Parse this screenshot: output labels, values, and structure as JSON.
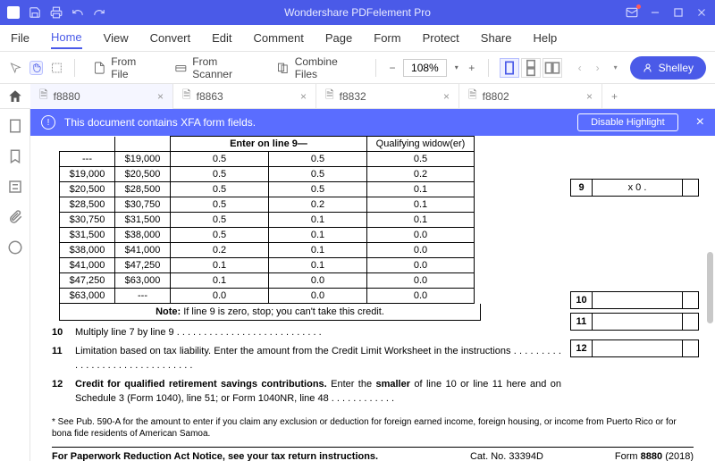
{
  "titlebar": {
    "title": "Wondershare PDFelement Pro"
  },
  "menu": [
    "File",
    "Home",
    "View",
    "Convert",
    "Edit",
    "Comment",
    "Page",
    "Form",
    "Protect",
    "Share",
    "Help"
  ],
  "menu_active": 1,
  "toolbar": {
    "from_file": "From File",
    "from_scanner": "From Scanner",
    "combine": "Combine Files",
    "zoom": "108%",
    "user": "Shelley"
  },
  "tabs": [
    {
      "label": "f8880",
      "active": true
    },
    {
      "label": "f8863",
      "active": false
    },
    {
      "label": "f8832",
      "active": false
    },
    {
      "label": "f8802",
      "active": false
    }
  ],
  "banner": {
    "text": "This document contains XFA form fields.",
    "button": "Disable Highlight"
  },
  "doc": {
    "header_enter": "Enter on line 9—",
    "header_qw": "Qualifying widow(er)",
    "rows": [
      {
        "c1": "---",
        "c2": "$19,000",
        "c3": "0.5",
        "c4": "0.5",
        "c5": "0.5"
      },
      {
        "c1": "$19,000",
        "c2": "$20,500",
        "c3": "0.5",
        "c4": "0.5",
        "c5": "0.2"
      },
      {
        "c1": "$20,500",
        "c2": "$28,500",
        "c3": "0.5",
        "c4": "0.5",
        "c5": "0.1"
      },
      {
        "c1": "$28,500",
        "c2": "$30,750",
        "c3": "0.5",
        "c4": "0.2",
        "c5": "0.1"
      },
      {
        "c1": "$30,750",
        "c2": "$31,500",
        "c3": "0.5",
        "c4": "0.1",
        "c5": "0.1"
      },
      {
        "c1": "$31,500",
        "c2": "$38,000",
        "c3": "0.5",
        "c4": "0.1",
        "c5": "0.0"
      },
      {
        "c1": "$38,000",
        "c2": "$41,000",
        "c3": "0.2",
        "c4": "0.1",
        "c5": "0.0"
      },
      {
        "c1": "$41,000",
        "c2": "$47,250",
        "c3": "0.1",
        "c4": "0.1",
        "c5": "0.0"
      },
      {
        "c1": "$47,250",
        "c2": "$63,000",
        "c3": "0.1",
        "c4": "0.0",
        "c5": "0.0"
      },
      {
        "c1": "$63,000",
        "c2": "---",
        "c3": "0.0",
        "c4": "0.0",
        "c5": "0.0"
      }
    ],
    "note": "Note: If line 9 is zero, stop; you can't take this credit.",
    "note_bold": "Note:",
    "note_rest": " If line 9 is zero, stop; you can't take this credit.",
    "side9": {
      "num": "9",
      "val": "x 0 ."
    },
    "side10": {
      "num": "10"
    },
    "side11": {
      "num": "11"
    },
    "side12": {
      "num": "12"
    },
    "line10_num": "10",
    "line10": "Multiply line 7 by line 9  .   .   .   .   .   .   .   .   .   .   .   .   .   .   .   .   .   .   .   .   .   .   .   .   .   .   .",
    "line11_num": "11",
    "line11": "Limitation based on tax liability. Enter the amount from the Credit Limit Worksheet in the instructions    .   .   .   .   .   .   .   .   .   .   .   .   .   .   .   .   .   .   .   .   .   .   .   .   .   .   .   .   .   .   .",
    "line12_num": "12",
    "line12_a": "Credit for qualified retirement savings contributions.",
    "line12_b": " Enter the smaller of line 10 or line 11 here and on Schedule 3 (Form 1040), line 51; or Form 1040NR, line 48    .   .   .   .   .   .   .   .   .   .   .   .",
    "line12_b1": " Enter the ",
    "line12_b2": "smaller",
    "line12_b3": " of line 10 or line 11 here and on Schedule 3 (Form 1040), line 51; or Form 1040NR, line 48    .   .   .   .   .   .   .   .   .   .   .   .",
    "footnote": "* See Pub. 590-A for the amount to enter if you claim any exclusion or deduction for foreign earned income, foreign housing, or income from Puerto Rico or for bona fide residents of American Samoa.",
    "footer_left": "For Paperwork Reduction Act Notice, see your tax return instructions.",
    "footer_mid": "Cat. No. 33394D",
    "footer_right_a": "Form ",
    "footer_right_b": "8880",
    "footer_right_c": " (2018)"
  }
}
